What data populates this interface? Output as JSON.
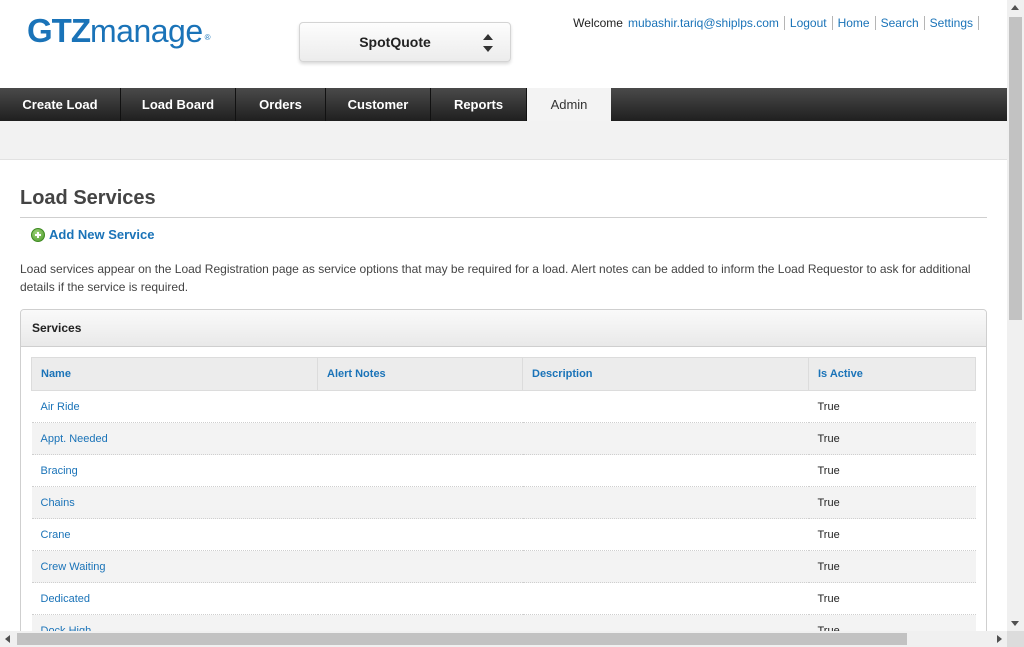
{
  "header": {
    "logo_bold": "GTZ",
    "logo_rest": "manage",
    "logo_mark": "®",
    "product": "SpotQuote",
    "welcome": "Welcome",
    "user_email": "mubashir.tariq@shiplps.com",
    "links": [
      "Logout",
      "Home",
      "Search",
      "Settings"
    ]
  },
  "nav": {
    "tabs": [
      "Create Load",
      "Load Board",
      "Orders",
      "Customer",
      "Reports",
      "Admin"
    ],
    "active": "Admin"
  },
  "main": {
    "title": "Load Services",
    "add_button": "Add New Service",
    "description": "Load services appear on the Load Registration page as service options that may be required for a load. Alert notes can be added to inform the Load Requestor to ask for additional details if the service is required.",
    "panel_title": "Services",
    "table": {
      "columns": [
        "Name",
        "Alert Notes",
        "Description",
        "Is Active"
      ],
      "rows": [
        {
          "name": "Air Ride",
          "alert": "",
          "desc": "",
          "active": "True"
        },
        {
          "name": "Appt. Needed",
          "alert": "",
          "desc": "",
          "active": "True"
        },
        {
          "name": "Bracing",
          "alert": "",
          "desc": "",
          "active": "True"
        },
        {
          "name": "Chains",
          "alert": "",
          "desc": "",
          "active": "True"
        },
        {
          "name": "Crane",
          "alert": "",
          "desc": "",
          "active": "True"
        },
        {
          "name": "Crew Waiting",
          "alert": "",
          "desc": "",
          "active": "True"
        },
        {
          "name": "Dedicated",
          "alert": "",
          "desc": "",
          "active": "True"
        },
        {
          "name": "Dock High",
          "alert": "",
          "desc": "",
          "active": "True"
        }
      ]
    }
  },
  "colors": {
    "brand_blue": "#1a73b8",
    "nav_dark": "#2a2a2a",
    "add_green": "#4b9a2a"
  }
}
